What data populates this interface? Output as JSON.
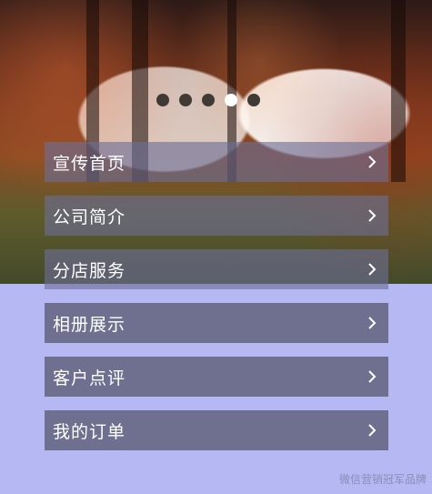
{
  "carousel": {
    "indicator_count": 5,
    "active_index": 3
  },
  "menu": {
    "items": [
      {
        "label": "宣传首页",
        "icon": "chevron-right-icon"
      },
      {
        "label": "公司简介",
        "icon": "chevron-right-icon"
      },
      {
        "label": "分店服务",
        "icon": "chevron-right-icon"
      },
      {
        "label": "相册展示",
        "icon": "chevron-right-icon"
      },
      {
        "label": "客户点评",
        "icon": "chevron-right-icon"
      },
      {
        "label": "我的订单",
        "icon": "chevron-right-icon"
      }
    ]
  },
  "watermark": "微信营销冠军品牌",
  "colors": {
    "background": "#b6b8f4",
    "menu_item": "#6f708f",
    "text": "#ffffff"
  }
}
